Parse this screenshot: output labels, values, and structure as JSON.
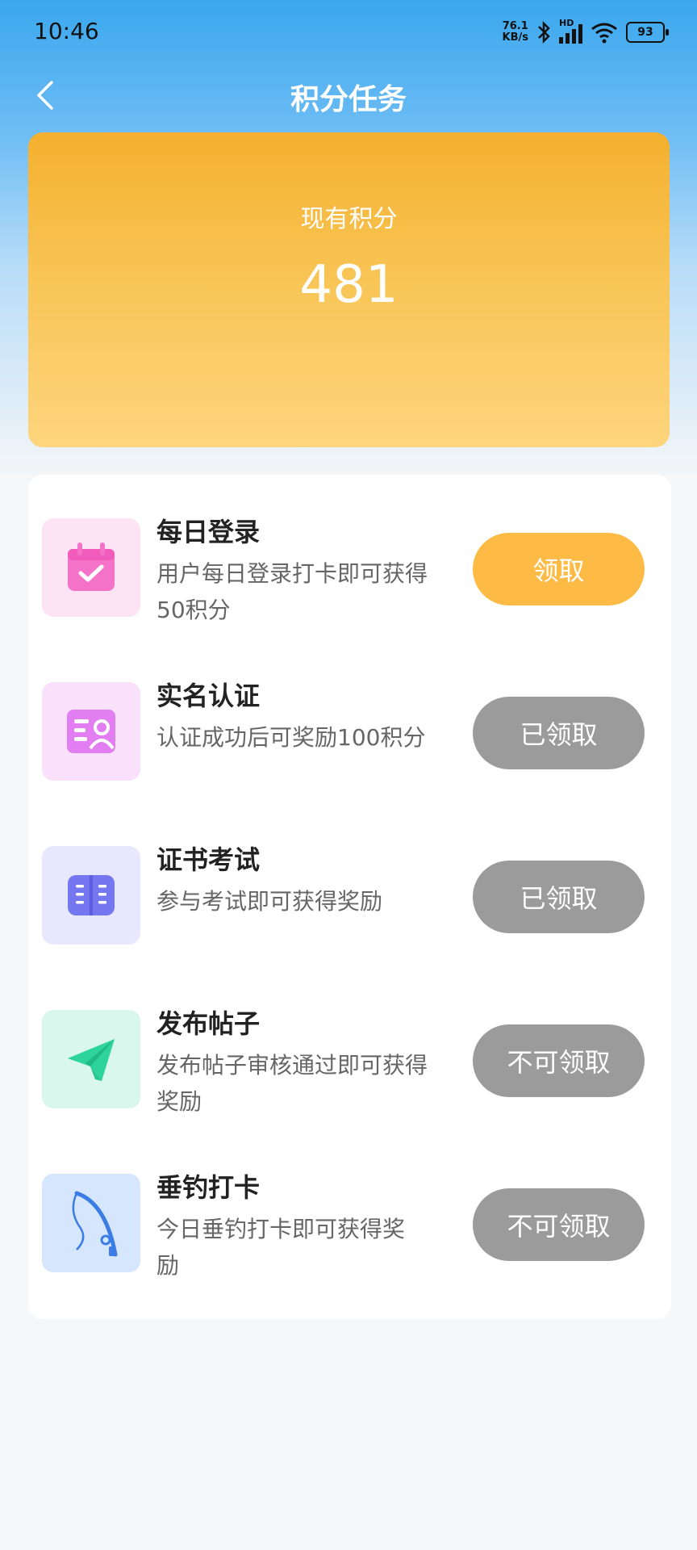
{
  "status_bar": {
    "time": "10:46",
    "net_speed_top": "76.1",
    "net_speed_bottom": "KB/s",
    "signal_label": "HD",
    "battery": "93"
  },
  "nav": {
    "title": "积分任务",
    "back_icon": "chevron-left-icon"
  },
  "points": {
    "label": "现有积分",
    "value": "481"
  },
  "tasks": [
    {
      "title": "每日登录",
      "desc": "用户每日登录打卡即可获得50积分",
      "button": "领取",
      "button_state": "active",
      "icon": "calendar-check-icon",
      "icon_bg": "#fde4f4",
      "icon_color": "#f472c8"
    },
    {
      "title": "实名认证",
      "desc": "认证成功后可奖励100积分",
      "button": "已领取",
      "button_state": "done",
      "icon": "id-card-icon",
      "icon_bg": "#f9e1fb",
      "icon_color": "#e27ef2"
    },
    {
      "title": "证书考试",
      "desc": "参与考试即可获得奖励",
      "button": "已领取",
      "button_state": "done",
      "icon": "book-icon",
      "icon_bg": "#e7e8fd",
      "icon_color": "#7577f0"
    },
    {
      "title": "发布帖子",
      "desc": "发布帖子审核通过即可获得奖励",
      "button": "不可领取",
      "button_state": "done",
      "icon": "paper-plane-icon",
      "icon_bg": "#d9f7ec",
      "icon_color": "#2fd39c"
    },
    {
      "title": "垂钓打卡",
      "desc": "今日垂钓打卡即可获得奖励",
      "button": "不可领取",
      "button_state": "done",
      "icon": "fishing-rod-icon",
      "icon_bg": "#d6e6fd",
      "icon_color": "#3c7de5"
    }
  ],
  "colors": {
    "accent_orange": "#fdbb45",
    "disabled_gray": "#9b9b9b",
    "header_blue": "#3aa7ee"
  }
}
